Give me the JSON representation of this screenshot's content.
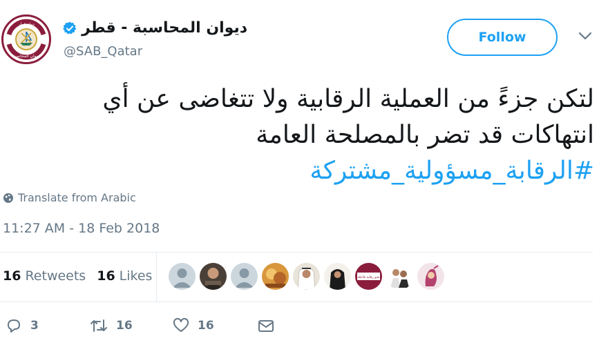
{
  "account": {
    "display_name": "ديوان المحاسبة - قطر",
    "handle": "@SAB_Qatar",
    "verified_icon": "verified-badge-icon",
    "avatar_text": "ديوان المحاسبة",
    "avatar_emblem_text": "دولة قطر"
  },
  "header": {
    "follow_label": "Follow",
    "menu_icon": "chevron-down-icon"
  },
  "tweet": {
    "line1": "لتكن جزءً من العملية الرقابية ولا تتغاضى عن أي",
    "line2": "انتهاكات قد تضر بالمصلحة العامة",
    "hashtag": "#الرقابة_مسؤولية_مشتركة",
    "translate_label": "Translate from Arabic",
    "timestamp": "11:27 AM - 18 Feb 2018"
  },
  "stats": {
    "retweets_count": "16",
    "retweets_label": "Retweets",
    "likes_count": "16",
    "likes_label": "Likes",
    "badge_text": "نحو رقابة فاعلة"
  },
  "actions": {
    "reply_count": "3",
    "retweet_count": "16",
    "like_count": "16"
  },
  "colors": {
    "accent": "#1da1f2",
    "text": "#14171a",
    "secondary": "#657786",
    "border": "#e6ecf0",
    "brand": "#8b1d3c"
  }
}
